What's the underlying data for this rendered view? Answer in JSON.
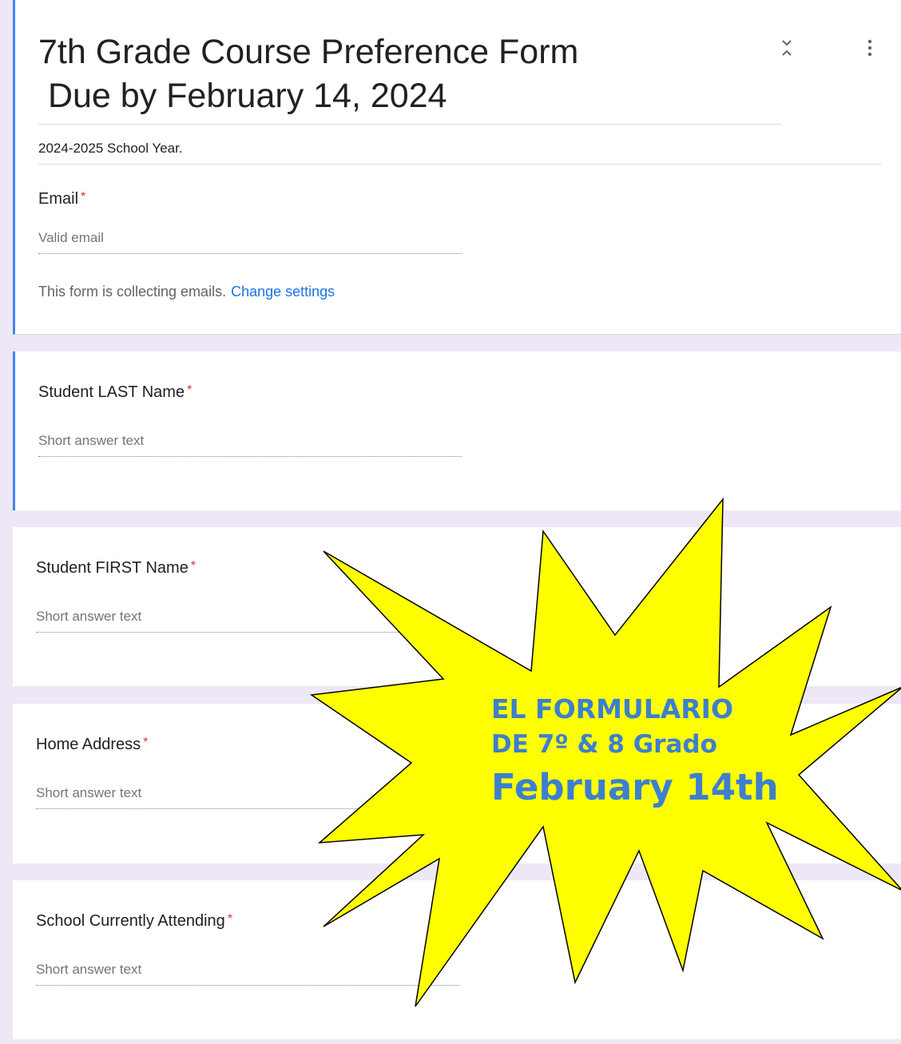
{
  "form": {
    "title_line1": "7th Grade Course Preference Form",
    "title_line2": " Due by February 14, 2024",
    "description": "2024-2025 School Year.",
    "required_mark": "*"
  },
  "header_icons": {
    "collapse": "collapse-icon",
    "more": "more-vert-icon"
  },
  "email": {
    "label": "Email",
    "placeholder": "Valid email",
    "notice": "This form is collecting emails.",
    "link": "Change settings"
  },
  "questions": [
    {
      "label": "Student LAST Name",
      "placeholder": "Short answer text"
    },
    {
      "label": "Student FIRST Name",
      "placeholder": "Short answer text"
    },
    {
      "label": "Home Address",
      "placeholder": "Short answer text"
    },
    {
      "label": "School Currently Attending",
      "placeholder": "Short answer text"
    }
  ],
  "burst": {
    "line1": "EL FORMULARIO",
    "line2": "DE 7º  & 8 Grado",
    "line3": "February 14th",
    "fill": "#ffff00",
    "text_color": "#3d7fcf"
  },
  "colors": {
    "accent": "#4285f4",
    "background": "#ede7f6",
    "required": "#d93025",
    "link": "#1a73e8"
  }
}
